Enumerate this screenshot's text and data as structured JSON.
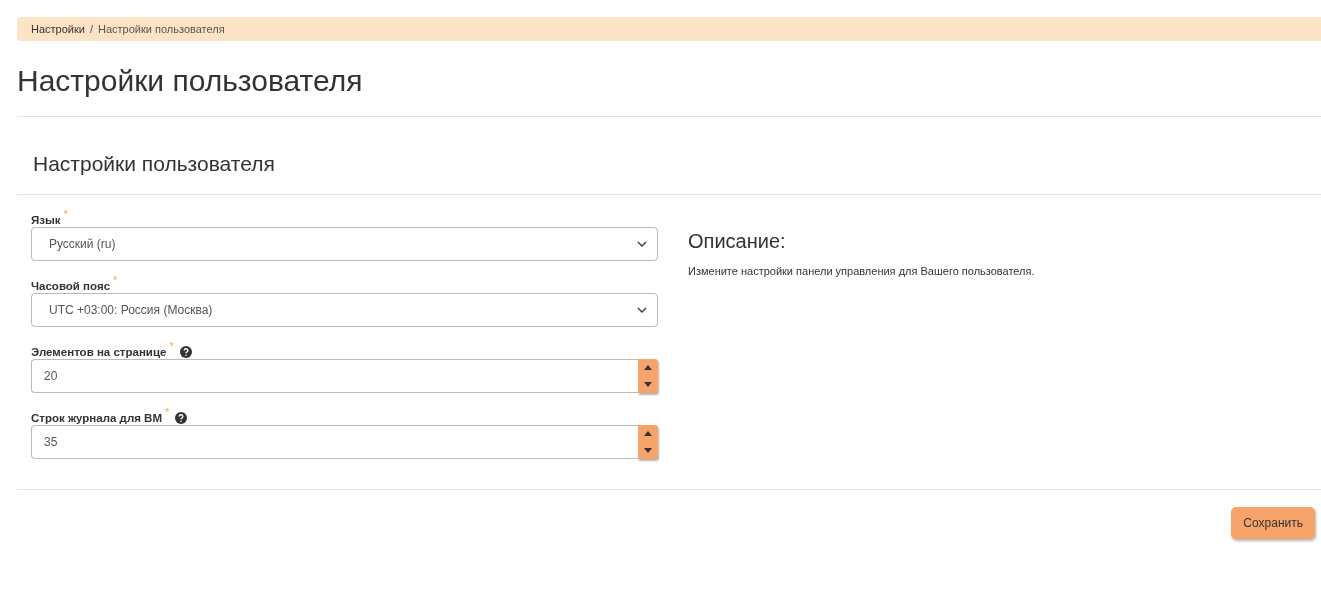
{
  "breadcrumb": [
    {
      "label": "Настройки",
      "selected": false
    },
    {
      "label": "Настройки пользователя",
      "selected": true
    }
  ],
  "breadcrumb_separator": "/",
  "page_title": "Настройки пользователя",
  "panel_title": "Настройки пользователя",
  "fields": [
    {
      "kind": "select",
      "label": "Язык",
      "required_mark": "*",
      "help": false,
      "value": "Русский (ru)"
    },
    {
      "kind": "select",
      "label": "Часовой пояс",
      "required_mark": "*",
      "help": false,
      "value": "UTC +03:00: Россия (Москва)"
    },
    {
      "kind": "number",
      "label": "Элементов на странице",
      "required_mark": "*",
      "help": true,
      "value": "20"
    },
    {
      "kind": "number",
      "label": "Строк журнала для ВМ",
      "required_mark": "*",
      "help": true,
      "value": "35"
    }
  ],
  "description": {
    "title": "Описание:",
    "text": "Измените настройки панели управления для Вашего пользователя."
  },
  "save_button": "Сохранить"
}
